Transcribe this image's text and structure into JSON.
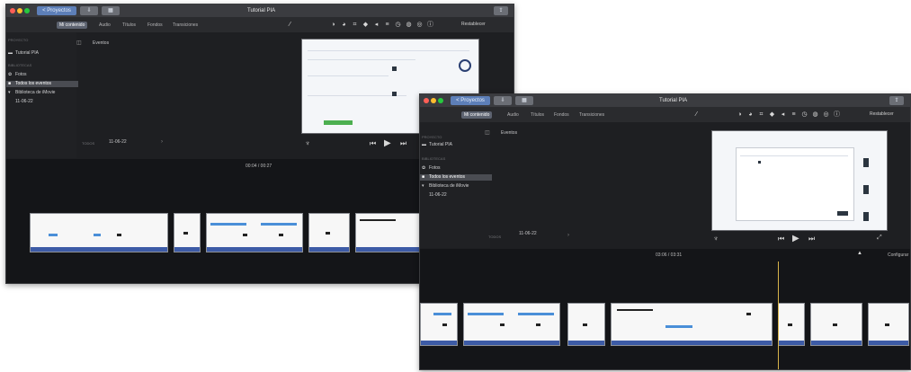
{
  "windows": [
    {
      "title": "Tutorial PIA",
      "projects_label": "< Proyectos",
      "tabs": [
        "Mi contenido",
        "Audio",
        "Títulos",
        "Fondos",
        "Transiciones"
      ],
      "selected_tab": "Mi contenido",
      "reset_label": "Restablecer",
      "events_label": "Eventos",
      "sidebar": {
        "proyecto_header": "PROYECTO",
        "project_item": "Tutorial PIA",
        "bibliotecas_header": "BIBLIOTECAS",
        "items": [
          "Fotos",
          "Todos los eventos"
        ],
        "library": "Biblioteca de iMovie",
        "event": "11-06-22"
      },
      "browser_date": "11-06-22",
      "browser_left": "TODOS",
      "timecode": "00:04 / 00:27"
    },
    {
      "title": "Tutorial PIA",
      "projects_label": "< Proyectos",
      "tabs": [
        "Mi contenido",
        "Audio",
        "Títulos",
        "Fondos",
        "Transiciones"
      ],
      "selected_tab": "Mi contenido",
      "reset_label": "Restablecer",
      "events_label": "Eventos",
      "sidebar": {
        "proyecto_header": "PROYECTO",
        "project_item": "Tutorial PIA",
        "bibliotecas_header": "BIBLIOTECAS",
        "items": [
          "Fotos",
          "Todos los eventos"
        ],
        "library": "Biblioteca de iMovie",
        "event": "11-06-22"
      },
      "browser_date": "11-06-22",
      "browser_left": "TODOS",
      "timecode": "03:06 / 03:31",
      "settings_label": "Configurar"
    }
  ],
  "colors": {
    "selected_tab": "#5d6370",
    "audio_strip": "#3d5ba6",
    "playhead": "#d8b44a",
    "accent_button": "#5d7fb8"
  }
}
